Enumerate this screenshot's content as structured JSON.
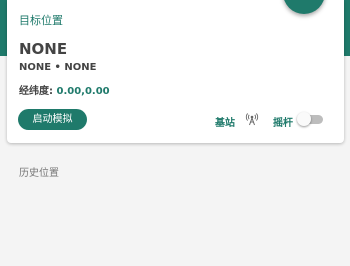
{
  "colors": {
    "accent": "#1f7a6b",
    "background": "#f4f4f4",
    "card": "#ffffff",
    "text_dark": "#444444",
    "text_muted": "#777777"
  },
  "target": {
    "title": "目标位置",
    "name": "NONE",
    "subtitle": "NONE • NONE",
    "coords_label": "经纬度: ",
    "coords_value": "0.00,0.00",
    "start_button": "启动模拟"
  },
  "controls": {
    "base_station_label": "基站",
    "base_station_icon": "antenna-icon",
    "joystick_label": "摇杆",
    "joystick_enabled": false
  },
  "history": {
    "title": "历史位置"
  }
}
